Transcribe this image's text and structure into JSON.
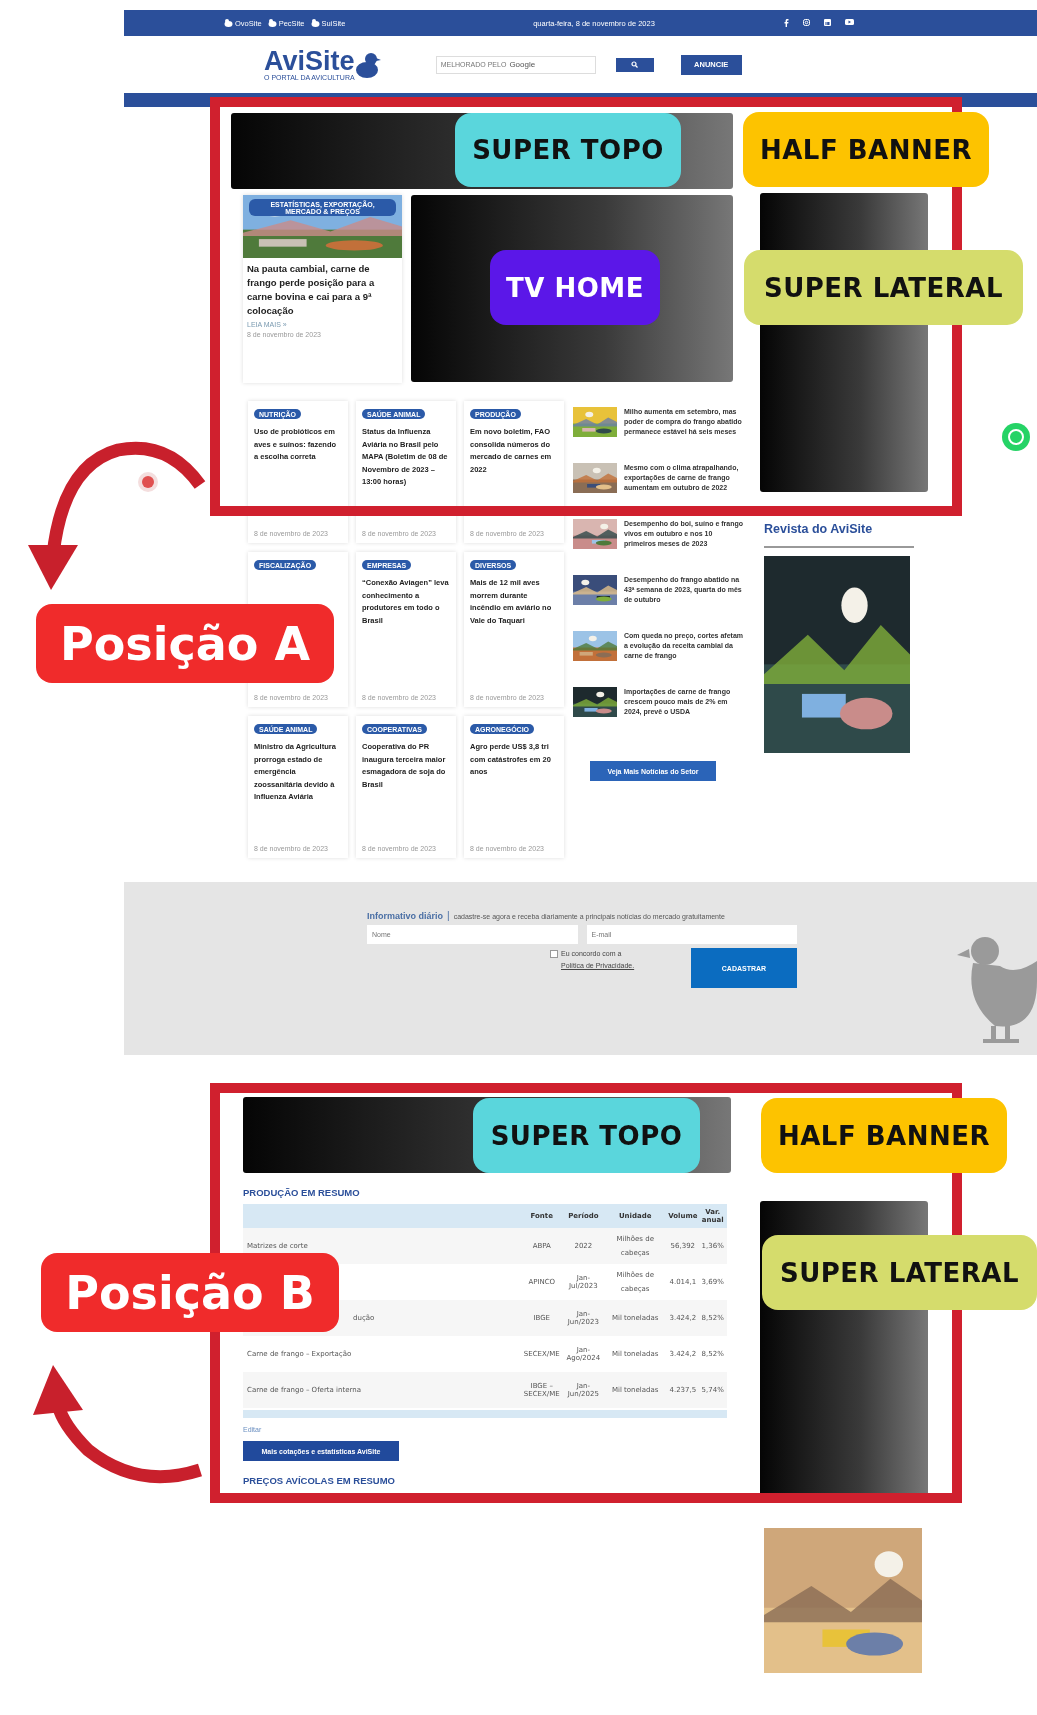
{
  "top_bar": {
    "sites": [
      {
        "label": "OvoSite"
      },
      {
        "label": "PecSite"
      },
      {
        "label": "SuiSite"
      }
    ],
    "date": "quarta-feira, 8 de novembro de 2023"
  },
  "header": {
    "logo": "AviSite",
    "tagline": "O PORTAL DA AVICULTURA",
    "search_label": "MELHORADO PELO",
    "search_brand": "Google",
    "cta": "ANUNCIE"
  },
  "featured": {
    "tag": "ESTATÍSTICAS, EXPORTAÇÃO, MERCADO & PREÇOS",
    "title": "Na pauta cambial, carne de frango perde posição para a carne bovina e cai para a 9ª colocação",
    "read_more": "LEIA MAIS »",
    "date": "8 de novembro de 2023"
  },
  "cards": [
    {
      "tag": "NUTRIÇÃO",
      "title": "Uso de probióticos em aves e suínos: fazendo a escolha correta",
      "date": "8 de novembro de 2023"
    },
    {
      "tag": "SAÚDE ANIMAL",
      "title": "Status da Influenza Aviária no Brasil pelo MAPA (Boletim de 08 de Novembro de 2023 – 13:00 horas)",
      "date": "8 de novembro de 2023"
    },
    {
      "tag": "PRODUÇÃO",
      "title": "Em novo boletim, FAO consolida números do mercado de carnes em 2022",
      "date": "8 de novembro de 2023"
    },
    {
      "tag": "FISCALIZAÇÃO",
      "date": "8 de novembro de 2023"
    },
    {
      "tag": "EMPRESAS",
      "title": "“Conexão Aviagen” leva conhecimento a produtores em todo o Brasil",
      "date": "8 de novembro de 2023"
    },
    {
      "tag": "DIVERSOS",
      "title": "Mais de 12 mil aves morrem durante incêndio em aviário no Vale do Taquari",
      "date": "8 de novembro de 2023"
    },
    {
      "tag": "SAÚDE ANIMAL",
      "title": "Ministro da Agricultura prorroga estado de emergência zoossanitária devido à Influenza Aviária",
      "date": "8 de novembro de 2023"
    },
    {
      "tag": "COOPERATIVAS",
      "title": "Cooperativa do PR inaugura terceira maior esmagadora de soja do Brasil",
      "date": "8 de novembro de 2023"
    },
    {
      "tag": "AGRONEGÓCIO",
      "title": "Agro perde US$ 3,8 tri com catástrofes em 20 anos",
      "date": "8 de novembro de 2023"
    }
  ],
  "side_news": [
    {
      "title": "Milho aumenta em setembro, mas poder de compra do frango abatido permanece estável há seis meses"
    },
    {
      "title": "Mesmo com o clima atrapalhando, exportações de carne de frango aumentam em outubro de 2022"
    },
    {
      "title": "Desempenho do boi, suíno e frango vivos em outubro e nos 10 primeiros meses de 2023"
    },
    {
      "title": "Desempenho do frango abatido na 43ª semana de 2023, quarta do mês de outubro"
    },
    {
      "title": "Com queda no preço, cortes afetam a evolução da receita cambial da carne de frango"
    },
    {
      "title": "Importações de carne de frango crescem pouco mais de 2% em 2024, prevê o USDA"
    }
  ],
  "more_button": "Veja Mais Notícias do Setor",
  "sidebar_heading": "Revista do AviSite",
  "newsletter": {
    "title": "Informativo diário",
    "separator": "|",
    "subtitle": "cadastre-se agora e receba diariamente a principais notícias do mercado gratuitamente",
    "name_placeholder": "Nome",
    "email_placeholder": "E-mail",
    "consent": "Eu concordo com a",
    "consent_link": "Política de Privacidade.",
    "checked": false,
    "button": "CADASTRAR"
  },
  "production": {
    "title": "PRODUÇÃO EM RESUMO",
    "columns": [
      "",
      "Fonte",
      "Período",
      "Unidade",
      "Volume",
      "Var. anual"
    ],
    "rows": [
      [
        "Matrizes de corte",
        "ABPA",
        "2022",
        "Milhões de cabeças",
        "56,392",
        "1,36%"
      ],
      [
        "",
        "APINCO",
        "Jan-Jul/2023",
        "Milhões de cabeças",
        "4.014,1",
        "3,69%"
      ],
      [
        "dução",
        "IBGE",
        "Jan-Jun/2023",
        "Mil toneladas",
        "3.424,2",
        "8,52%"
      ],
      [
        "Carne de frango – Exportação",
        "SECEX/ME",
        "Jan-Ago/2024",
        "Mil toneladas",
        "3.424,2",
        "8,52%"
      ],
      [
        "Carne de frango – Oferta interna",
        "IBGE – SECEX/ME",
        "Jan-Jun/2025",
        "Mil toneladas",
        "4.237,5",
        "5,74%"
      ]
    ],
    "edit": "Editar",
    "button": "Mais cotações e estatísticas AviSite",
    "next_title": "PREÇOS AVÍCOLAS EM RESUMO"
  },
  "positions": [
    {
      "label": "Posição A",
      "slots": [
        {
          "kind": "super_topo",
          "label": "SUPER TOPO",
          "color": "#5ad6dc"
        },
        {
          "kind": "half_banner",
          "label": "HALF BANNER",
          "color": "#fdc300"
        },
        {
          "kind": "tv_home",
          "label": "TV HOME",
          "color": "#5b17e8"
        },
        {
          "kind": "super_lateral",
          "label": "SUPER LATERAL",
          "color": "#d5dc6c"
        }
      ]
    },
    {
      "label": "Posição B",
      "slots": [
        {
          "kind": "super_topo",
          "label": "SUPER TOPO",
          "color": "#5ad6dc"
        },
        {
          "kind": "half_banner",
          "label": "HALF BANNER",
          "color": "#fdc300"
        },
        {
          "kind": "super_lateral",
          "label": "SUPER LATERAL",
          "color": "#d5dc6c"
        }
      ]
    }
  ]
}
